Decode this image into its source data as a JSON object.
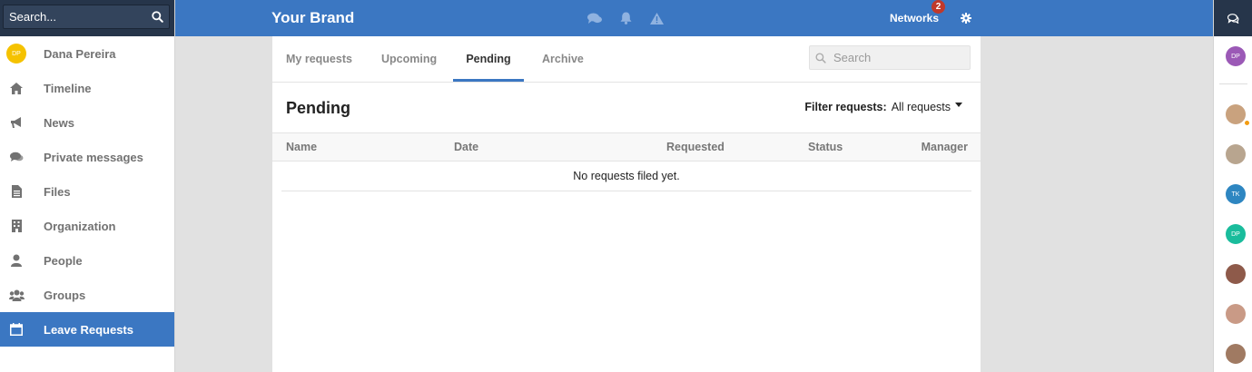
{
  "sidebar": {
    "search_placeholder": "Search...",
    "user": {
      "name": "Dana Pereira",
      "initials": "DP"
    },
    "items": [
      {
        "label": "Timeline",
        "icon": "home-icon"
      },
      {
        "label": "News",
        "icon": "megaphone-icon"
      },
      {
        "label": "Private messages",
        "icon": "chat-icon"
      },
      {
        "label": "Files",
        "icon": "file-icon"
      },
      {
        "label": "Organization",
        "icon": "building-icon"
      },
      {
        "label": "People",
        "icon": "person-icon"
      },
      {
        "label": "Groups",
        "icon": "users-icon"
      },
      {
        "label": "Leave Requests",
        "icon": "calendar-icon",
        "active": true
      }
    ]
  },
  "topbar": {
    "brand": "Your Brand",
    "networks_label": "Networks",
    "networks_badge": "2"
  },
  "tabs": [
    {
      "label": "My requests"
    },
    {
      "label": "Upcoming"
    },
    {
      "label": "Pending",
      "active": true
    },
    {
      "label": "Archive"
    }
  ],
  "panel_search": {
    "placeholder": "Search"
  },
  "page": {
    "title": "Pending",
    "filter_label": "Filter requests:",
    "filter_value": "All requests"
  },
  "table": {
    "columns": [
      "Name",
      "Date",
      "Requested",
      "Status",
      "Manager"
    ],
    "empty_message": "No requests filed yet."
  },
  "right_rail": {
    "avatars": [
      {
        "initials": "DP",
        "color": "#9b59b6"
      },
      {
        "initials": "",
        "color": "#c9a27e"
      },
      {
        "initials": "",
        "color": "#b8a58f"
      },
      {
        "initials": "TK",
        "color": "#2e86c1"
      },
      {
        "initials": "DP",
        "color": "#1abc9c"
      },
      {
        "initials": "",
        "color": "#8e5a4a"
      },
      {
        "initials": "",
        "color": "#c99a86"
      },
      {
        "initials": "",
        "color": "#a07a62"
      }
    ]
  },
  "colors": {
    "accent": "#3b77c2",
    "dark_navy": "#26354a",
    "badge": "#c0392b"
  }
}
